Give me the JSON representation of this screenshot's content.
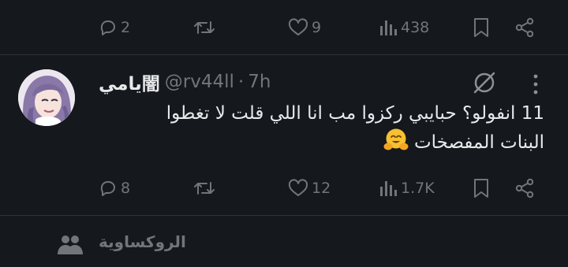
{
  "prev_tweet": {
    "actions": {
      "replies": "2",
      "retweets": "",
      "likes": "9",
      "views": "438"
    }
  },
  "tweet": {
    "display_name": "يامي闇",
    "handle": "@rv44ll",
    "separator": "·",
    "time": "7h",
    "text_line1": "11 انفولو؟ حبايبي ركزوا مب انا اللي قلت لا تغطوا",
    "text_line2": "البنات المفصخات",
    "emoji": "hugging-face",
    "actions": {
      "replies": "8",
      "retweets": "",
      "likes": "12",
      "views": "1.7K"
    }
  },
  "community": {
    "name": "الروكساوية"
  },
  "colors": {
    "background": "#15181c",
    "text": "#e7e9ea",
    "muted": "#71767b",
    "divider": "#2f3336",
    "avatar_hair": "#8a78a8"
  }
}
